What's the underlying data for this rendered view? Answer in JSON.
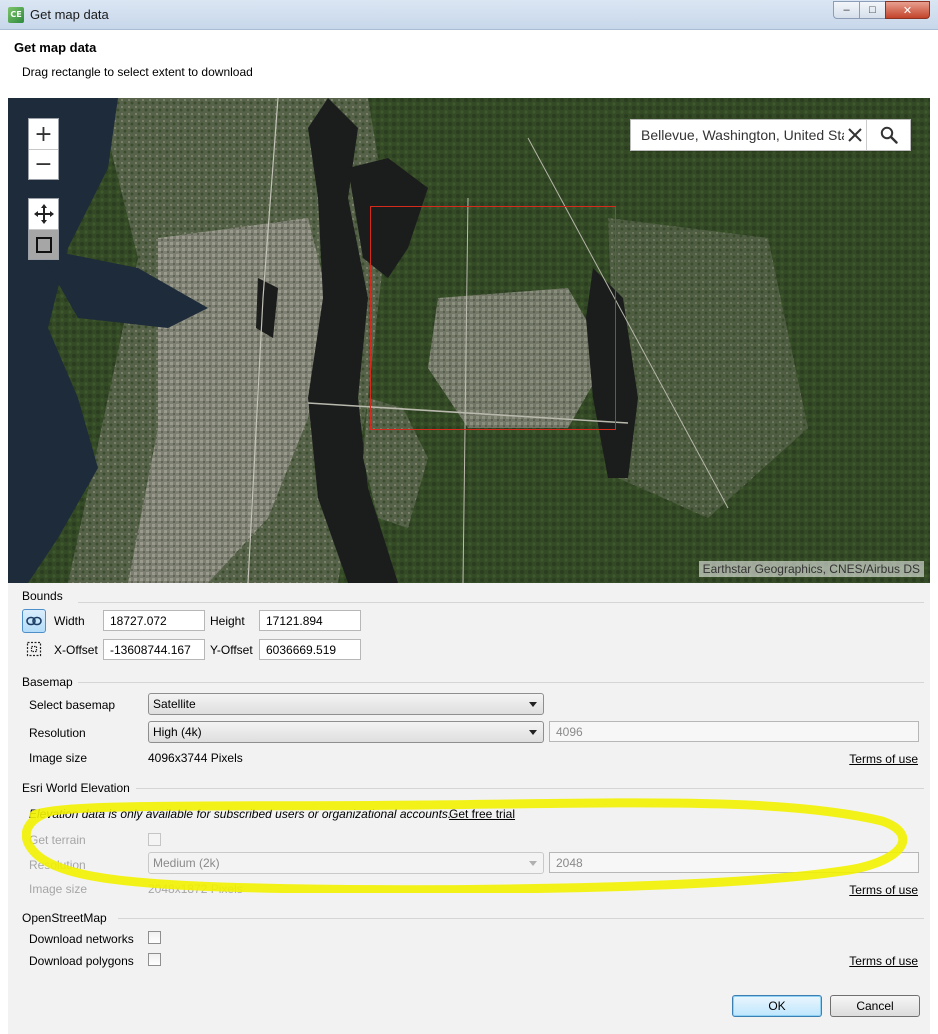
{
  "window": {
    "title": "Get map data",
    "app_icon_text": "CE",
    "controls": {
      "minimize": "–",
      "maximize": "□",
      "close": "✕"
    }
  },
  "header": {
    "title": "Get map data",
    "subtitle": "Drag rectangle to select extent to download"
  },
  "map": {
    "zoom_in": "+",
    "zoom_out": "−",
    "search": {
      "value": "Bellevue, Washington, United States"
    },
    "attribution": "Earthstar Geographics, CNES/Airbus DS",
    "icons": [
      "pan-icon",
      "rectangle-select-icon",
      "search-icon",
      "clear-icon"
    ]
  },
  "bounds": {
    "label": "Bounds",
    "width_label": "Width",
    "width_value": "18727.072",
    "height_label": "Height",
    "height_value": "17121.894",
    "xoffset_label": "X-Offset",
    "xoffset_value": "-13608744.167",
    "yoffset_label": "Y-Offset",
    "yoffset_value": "6036669.519"
  },
  "basemap": {
    "label": "Basemap",
    "select_label": "Select basemap",
    "select_value": "Satellite",
    "resolution_label": "Resolution",
    "resolution_value": "High (4k)",
    "resolution_pixels": "4096",
    "image_size_label": "Image size",
    "image_size_value": "4096x3744 Pixels",
    "terms": "Terms of use"
  },
  "elevation": {
    "label": "Esri World Elevation",
    "notice": "Elevation data is only available for subscribed users or organizational accounts.",
    "trial_link": "Get free trial",
    "terrain_label": "Get terrain",
    "resolution_label": "Resolution",
    "resolution_value": "Medium (2k)",
    "resolution_pixels": "2048",
    "image_size_label": "Image size",
    "image_size_value": "2048x1872 Pixels",
    "terms": "Terms of use"
  },
  "osm": {
    "label": "OpenStreetMap",
    "networks_label": "Download networks",
    "polygons_label": "Download polygons",
    "terms": "Terms of use"
  },
  "footer": {
    "ok": "OK",
    "cancel": "Cancel"
  },
  "colors": {
    "selection": "#d62a1c",
    "highlight": "#f2f200",
    "water": "#1b1d1c"
  }
}
